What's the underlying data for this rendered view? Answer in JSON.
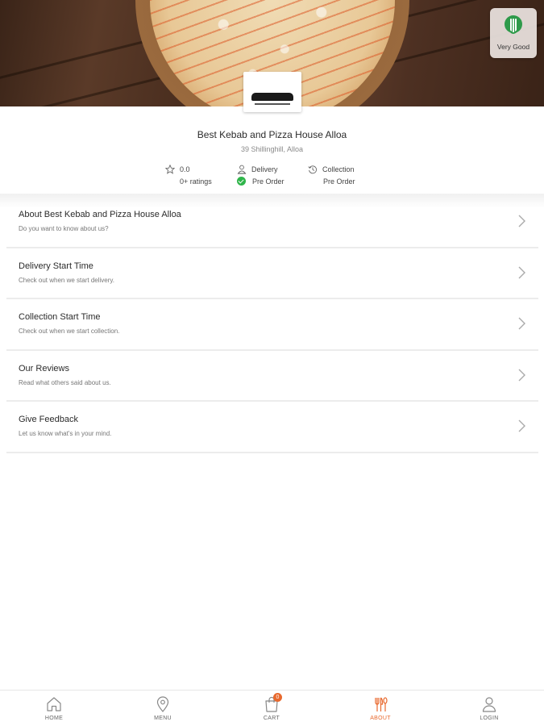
{
  "hero": {
    "rating_badge_label": "Very Good"
  },
  "store": {
    "name": "Best Kebab and Pizza House Alloa",
    "address": "39 Shillinghill, Alloa",
    "rating_value": "0.0",
    "ratings_count": "0+ ratings",
    "delivery_label": "Delivery",
    "delivery_status": "Pre Order",
    "collection_label": "Collection",
    "collection_status": "Pre Order"
  },
  "menu_items": [
    {
      "title": "About Best Kebab and Pizza House Alloa",
      "subtitle": "Do you want to know about us?"
    },
    {
      "title": "Delivery Start Time",
      "subtitle": "Check out when we start delivery."
    },
    {
      "title": "Collection Start Time",
      "subtitle": "Check out when we start collection."
    },
    {
      "title": "Our Reviews",
      "subtitle": "Read what others said about us."
    },
    {
      "title": "Give Feedback",
      "subtitle": "Let us know what's in your mind."
    }
  ],
  "bottom_nav": {
    "items": [
      {
        "label": "HOME",
        "icon": "home-icon"
      },
      {
        "label": "MENU",
        "icon": "map-pin-icon"
      },
      {
        "label": "CART",
        "icon": "cart-icon"
      },
      {
        "label": "ABOUT",
        "icon": "cutlery-icon"
      },
      {
        "label": "LOGIN",
        "icon": "user-icon"
      }
    ],
    "active": "ABOUT",
    "cart_count": "0"
  },
  "colors": {
    "accent": "#e8692e",
    "status_green": "#2fb54a",
    "badge_green": "#2e9a4a"
  }
}
